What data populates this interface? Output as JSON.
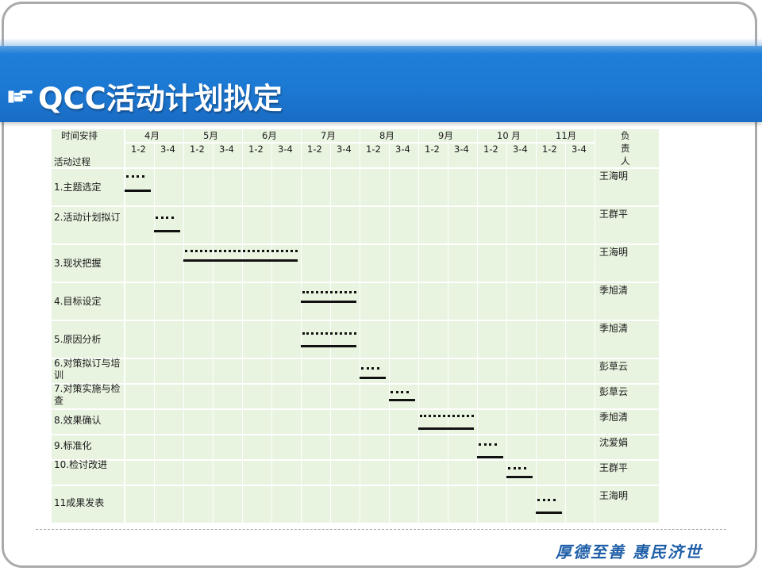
{
  "slide": {
    "title": "QCC活动计划拟定",
    "title_icon": "pointing-hand-icon",
    "motto": "厚德至善 惠民济世"
  },
  "colors": {
    "header_band": "#1c78d2",
    "table_bg": "#e8f3e0",
    "frame_border": "#a9aaab",
    "motto": "#1f5fa8"
  },
  "table": {
    "header_left": "时间安排",
    "header_left_sub": "活动过程",
    "months": [
      "4月",
      "5月",
      "6月",
      "7月",
      "8月",
      "9月",
      "10 月",
      "11月"
    ],
    "halves": [
      "1-2",
      "3-4"
    ],
    "resp_header": [
      "负",
      "责",
      "人"
    ],
    "rows": [
      {
        "activity": "1.主题选定",
        "responsible": "王海明"
      },
      {
        "activity": "2.活动计划拟订",
        "responsible": "王群平"
      },
      {
        "activity": "3.现状把握",
        "responsible": "王海明"
      },
      {
        "activity": "4.目标设定",
        "responsible": "季旭清"
      },
      {
        "activity": "5.原因分析",
        "responsible": "季旭清"
      },
      {
        "activity": "6.对策拟订与培训",
        "responsible": "彭草云"
      },
      {
        "activity": "7.对策实施与检查",
        "responsible": "彭草云"
      },
      {
        "activity": "8.效果确认",
        "responsible": "季旭清"
      },
      {
        "activity": "9.标准化",
        "responsible": "沈爱娟"
      },
      {
        "activity": "10.检讨改进",
        "responsible": "王群平"
      },
      {
        "activity": "11成果发表",
        "responsible": "王海明"
      }
    ]
  },
  "gantt": {
    "legend_note": "",
    "plan_style": "dotted",
    "actual_style": "solid",
    "bars": [
      {
        "row": 1,
        "plan_cols": [
          0,
          0
        ],
        "actual_cols": [
          0,
          0
        ]
      },
      {
        "row": 2,
        "plan_cols": [
          1,
          1
        ],
        "actual_cols": [
          1,
          1
        ]
      },
      {
        "row": 3,
        "plan_cols": [
          2,
          5
        ],
        "actual_cols": [
          2,
          5
        ]
      },
      {
        "row": 4,
        "plan_cols": [
          6,
          7
        ],
        "actual_cols": [
          6,
          7
        ]
      },
      {
        "row": 5,
        "plan_cols": [
          6,
          7
        ],
        "actual_cols": [
          6,
          7
        ]
      },
      {
        "row": 6,
        "plan_cols": [
          8,
          8
        ],
        "actual_cols": [
          8,
          8
        ]
      },
      {
        "row": 7,
        "plan_cols": [
          9,
          9
        ],
        "actual_cols": [
          9,
          9
        ]
      },
      {
        "row": 8,
        "plan_cols": [
          10,
          11
        ],
        "actual_cols": [
          10,
          11
        ]
      },
      {
        "row": 9,
        "plan_cols": [
          12,
          12
        ],
        "actual_cols": [
          12,
          12
        ]
      },
      {
        "row": 10,
        "plan_cols": [
          13,
          13
        ],
        "actual_cols": [
          13,
          13
        ]
      },
      {
        "row": 11,
        "plan_cols": [
          14,
          14
        ],
        "actual_cols": [
          14,
          14
        ]
      }
    ]
  }
}
